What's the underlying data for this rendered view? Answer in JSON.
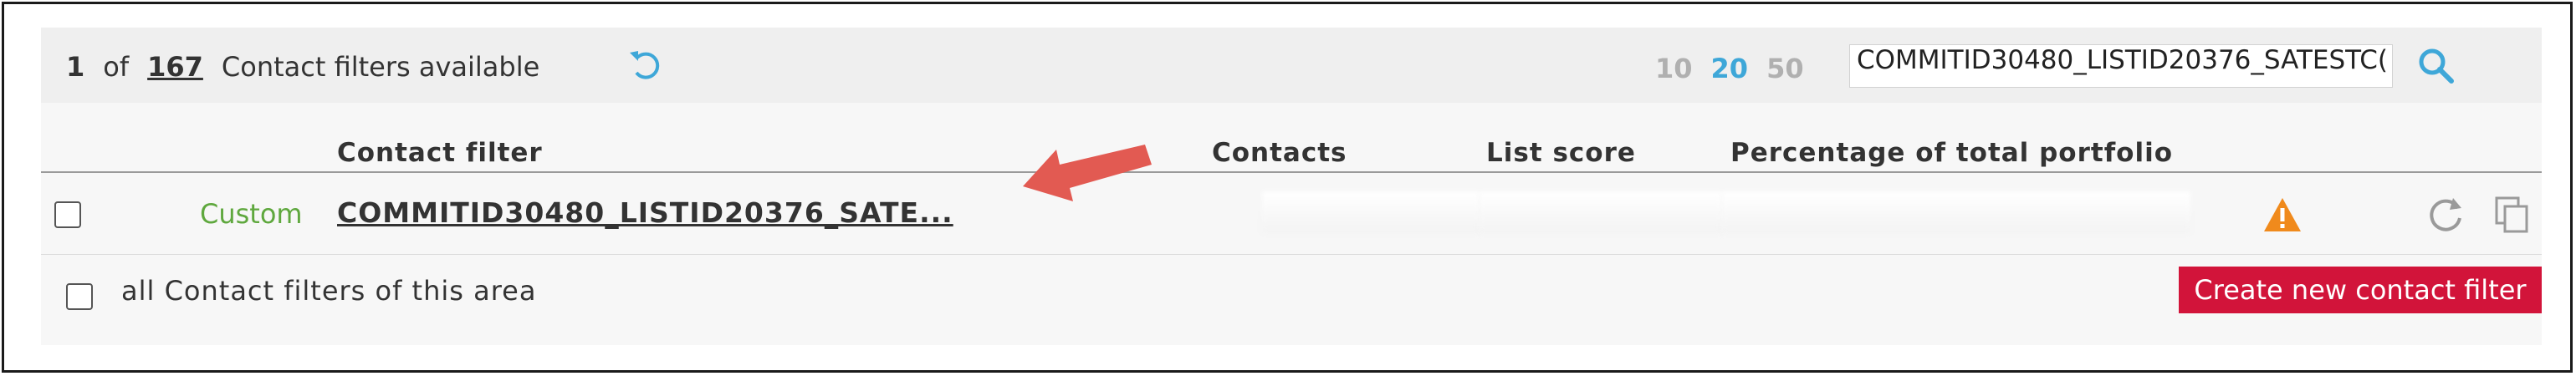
{
  "summary": {
    "current": "1",
    "of": "of",
    "total": "167",
    "label": "Contact filters available"
  },
  "pager": [
    "10",
    "20",
    "50"
  ],
  "pager_active": "20",
  "search": {
    "value": "COMMITID30480_LISTID20376_SATESTC("
  },
  "columns": {
    "filter": "Contact filter",
    "contacts": "Contacts",
    "score": "List score",
    "percentage": "Percentage of total portfolio"
  },
  "rows": [
    {
      "type": "Custom",
      "name": "COMMITID30480_LISTID20376_SATE..."
    }
  ],
  "footer": {
    "all_label": "all Contact filters of this area",
    "create_label": "Create new contact filter"
  },
  "colors": {
    "accent": "#3ea7d8",
    "custom_green": "#5fa83e",
    "create_red": "#d2143a",
    "warning_orange": "#f08a1c",
    "arrow_red": "#e25a52"
  },
  "icons": [
    "reset-icon",
    "search-icon",
    "warning-icon",
    "refresh-icon",
    "copy-icon"
  ]
}
